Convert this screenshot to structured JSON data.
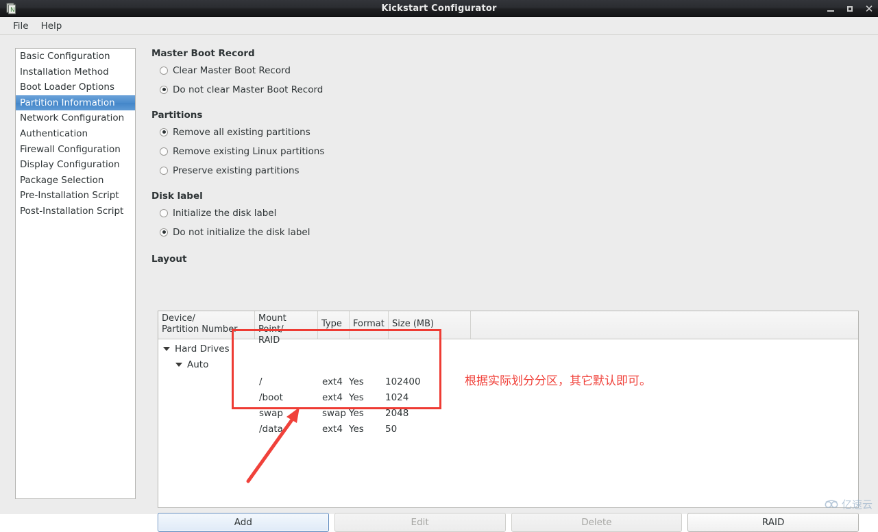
{
  "window": {
    "title": "Kickstart Configurator",
    "icon": "app-document-icon",
    "controls": {
      "minimize": "minimize-icon",
      "maximize": "maximize-icon",
      "close": "✕"
    }
  },
  "menubar": {
    "items": [
      {
        "label": "File"
      },
      {
        "label": "Help"
      }
    ]
  },
  "sidebar": {
    "selected_index": 3,
    "items": [
      {
        "label": "Basic Configuration"
      },
      {
        "label": "Installation Method"
      },
      {
        "label": "Boot Loader Options"
      },
      {
        "label": "Partition Information"
      },
      {
        "label": "Network Configuration"
      },
      {
        "label": "Authentication"
      },
      {
        "label": "Firewall Configuration"
      },
      {
        "label": "Display Configuration"
      },
      {
        "label": "Package Selection"
      },
      {
        "label": "Pre-Installation Script"
      },
      {
        "label": "Post-Installation Script"
      }
    ]
  },
  "sections": {
    "mbr": {
      "title": "Master Boot Record",
      "options": [
        {
          "label": "Clear Master Boot Record",
          "selected": false
        },
        {
          "label": "Do not clear Master Boot Record",
          "selected": true
        }
      ]
    },
    "partitions": {
      "title": "Partitions",
      "options": [
        {
          "label": "Remove all existing partitions",
          "selected": true
        },
        {
          "label": "Remove existing Linux partitions",
          "selected": false
        },
        {
          "label": "Preserve existing partitions",
          "selected": false
        }
      ]
    },
    "disklabel": {
      "title": "Disk label",
      "options": [
        {
          "label": "Initialize the disk label",
          "selected": false
        },
        {
          "label": "Do not initialize the disk label",
          "selected": true
        }
      ]
    },
    "layout": {
      "title": "Layout"
    }
  },
  "table": {
    "columns": [
      {
        "line1": "Device/",
        "line2": "Partition Number"
      },
      {
        "line1": "Mount Point/",
        "line2": "RAID"
      },
      {
        "line1": "Type",
        "line2": ""
      },
      {
        "line1": "Format",
        "line2": ""
      },
      {
        "line1": "Size (MB)",
        "line2": ""
      }
    ],
    "tree": {
      "root_label": "Hard Drives",
      "child_label": "Auto"
    },
    "rows": [
      {
        "mount": "/",
        "type": "ext4",
        "format": "Yes",
        "size": "102400"
      },
      {
        "mount": "/boot",
        "type": "ext4",
        "format": "Yes",
        "size": "1024"
      },
      {
        "mount": "swap",
        "type": "swap",
        "format": "Yes",
        "size": "2048"
      },
      {
        "mount": "/data",
        "type": "ext4",
        "format": "Yes",
        "size": "50"
      }
    ]
  },
  "buttons": [
    {
      "label": "Add",
      "state": "focused"
    },
    {
      "label": "Edit",
      "state": "disabled"
    },
    {
      "label": "Delete",
      "state": "disabled"
    },
    {
      "label": "RAID",
      "state": "normal"
    }
  ],
  "annotations": {
    "note_text": "根据实际划分分区，其它默认即可。",
    "highlight_color": "#ee3b33",
    "note_color": "#f0413a",
    "arrow": "red-arrow-icon"
  },
  "watermark": {
    "text": "亿速云",
    "icon": "cloud-logo-icon",
    "color": "#9fb6cd"
  }
}
